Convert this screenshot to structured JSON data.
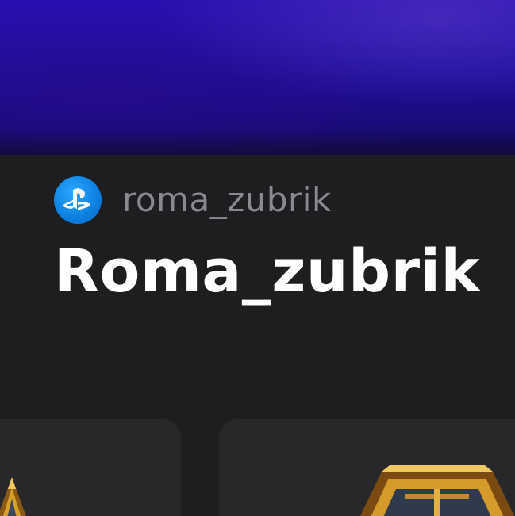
{
  "profile": {
    "platform_icon": "playstation-logo-icon",
    "online_id": "roma_zubrik",
    "display_name": "Roma_zubrik"
  },
  "colors": {
    "background": "#1e1e20",
    "banner": "#2010a0",
    "ps_blue": "#0b7fe0",
    "card": "#28282b",
    "online_id_text": "#8a8a8e",
    "display_name_text": "#ffffff"
  },
  "cards": [
    {
      "icon": "trophy-badge-icon"
    },
    {
      "icon": "trophy-badge-icon"
    }
  ]
}
